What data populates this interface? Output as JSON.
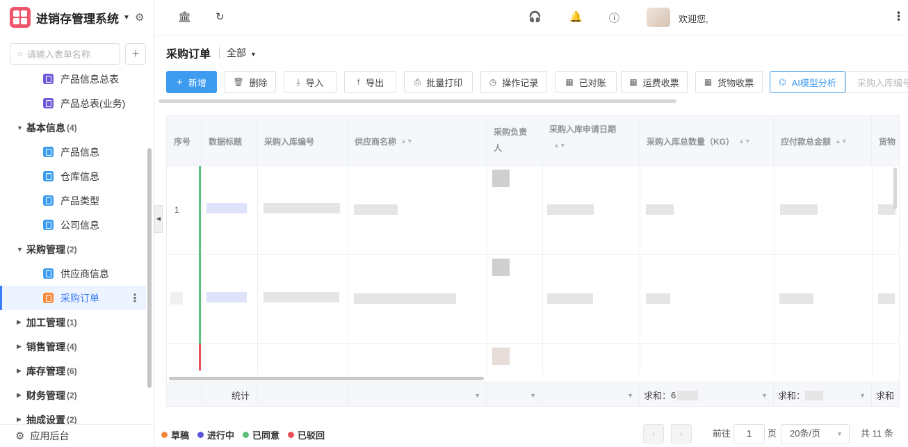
{
  "app": {
    "name": "进销存管理系统"
  },
  "sidebar": {
    "search_placeholder": "请输入表单名称",
    "add_label": "+",
    "items": [
      {
        "type": "leaf",
        "label": "产品信息总表",
        "color": "purple"
      },
      {
        "type": "leaf",
        "label": "产品总表(业务)",
        "color": "purple"
      },
      {
        "type": "group",
        "label": "基本信息",
        "count": "(4)",
        "expanded": true
      },
      {
        "type": "leaf",
        "label": "产品信息",
        "color": "blue"
      },
      {
        "type": "leaf",
        "label": "仓库信息",
        "color": "blue"
      },
      {
        "type": "leaf",
        "label": "产品类型",
        "color": "blue"
      },
      {
        "type": "leaf",
        "label": "公司信息",
        "color": "blue"
      },
      {
        "type": "group",
        "label": "采购管理",
        "count": "(2)",
        "expanded": true
      },
      {
        "type": "leaf",
        "label": "供应商信息",
        "color": "blue"
      },
      {
        "type": "leaf",
        "label": "采购订单",
        "color": "orange",
        "active": true
      },
      {
        "type": "group",
        "label": "加工管理",
        "count": "(1)",
        "expanded": false
      },
      {
        "type": "group",
        "label": "销售管理",
        "count": "(4)",
        "expanded": false
      },
      {
        "type": "group",
        "label": "库存管理",
        "count": "(6)",
        "expanded": false
      },
      {
        "type": "group",
        "label": "财务管理",
        "count": "(2)",
        "expanded": false
      },
      {
        "type": "group",
        "label": "抽成设置",
        "count": "(2)",
        "expanded": false
      }
    ],
    "backend_label": "应用后台"
  },
  "header": {
    "welcome": "欢迎您,"
  },
  "page": {
    "title": "采购订单",
    "filter": "全部"
  },
  "toolbar": {
    "add": "新增",
    "delete": "删除",
    "import": "导入",
    "export": "导出",
    "batch_print": "批量打印",
    "op_log": "操作记录",
    "reconciled": "已对账",
    "freight": "运费收票",
    "goods": "货物收票",
    "ai": "AI模型分析",
    "inbound_no": "采购入库编号"
  },
  "table": {
    "columns": {
      "index": "序号",
      "title": "数据标题",
      "inbound_no": "采购入库编号",
      "supplier": "供应商名称",
      "owner": "采购负责人",
      "apply_date": "采购入库申请日期",
      "total_qty": "采购入库总数量（KG）",
      "payable": "应付款总金额",
      "goods": "货物"
    },
    "rows": [
      {
        "index": "1",
        "status": "approved"
      },
      {
        "index": "",
        "status": "approved"
      },
      {
        "index": "",
        "status": "rejected"
      }
    ],
    "summary": {
      "label": "统计",
      "sum1": "求和：",
      "sum1_partial": "6",
      "sum2": "求和：",
      "sum3": "求和"
    }
  },
  "legend": [
    {
      "label": "草稿",
      "color": "#f7893a"
    },
    {
      "label": "进行中",
      "color": "#5b57d8"
    },
    {
      "label": "已同意",
      "color": "#5bbf7a"
    },
    {
      "label": "已驳回",
      "color": "#e8505b"
    }
  ],
  "pagination": {
    "goto": "前往",
    "page": "1",
    "page_unit": "页",
    "page_size": "20条/页",
    "total": "共 11 条"
  }
}
